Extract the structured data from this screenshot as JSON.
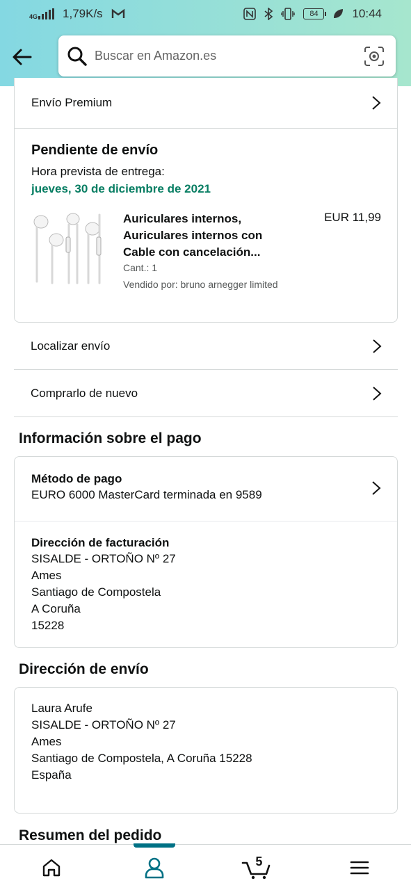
{
  "status_bar": {
    "network": "4G",
    "speed": "1,79K/s",
    "battery": "84",
    "time": "10:44"
  },
  "search": {
    "placeholder": "Buscar en Amazon.es"
  },
  "shipping_speed": {
    "label": "Envío Premium"
  },
  "shipment": {
    "title": "Pendiente de envío",
    "estimate_label": "Hora prevista de entrega:",
    "estimate_date": "jueves, 30 de diciembre de 2021",
    "product_name": "Auriculares internos, Auriculares internos con Cable con cancelación...",
    "price": "EUR 11,99",
    "quantity": "Cant.: 1",
    "seller": "Vendido por: bruno arnegger limited"
  },
  "actions": {
    "track": "Localizar envío",
    "buy_again": "Comprarlo de nuevo"
  },
  "payment": {
    "heading": "Información sobre el pago",
    "method_label": "Método de pago",
    "method_value": "EURO 6000 MasterCard terminada en 9589",
    "billing_label": "Dirección de facturación",
    "billing_lines": [
      "SISALDE - ORTOÑO Nº 27",
      "Ames",
      "Santiago de Compostela",
      "A Coruña",
      "15228"
    ]
  },
  "delivery_address": {
    "heading": "Dirección de envío",
    "lines": [
      "Laura Arufe",
      "SISALDE - ORTOÑO Nº 27",
      "Ames",
      "Santiago de Compostela, A Coruña 15228",
      "España"
    ]
  },
  "summary": {
    "heading": "Resumen del pedido"
  },
  "nav": {
    "cart_count": "5",
    "active": "account"
  },
  "colors": {
    "accent": "#007185",
    "delivery_green": "#067d62",
    "header_gradient_start": "#84d8e2",
    "header_gradient_end": "#a6e6ce"
  }
}
